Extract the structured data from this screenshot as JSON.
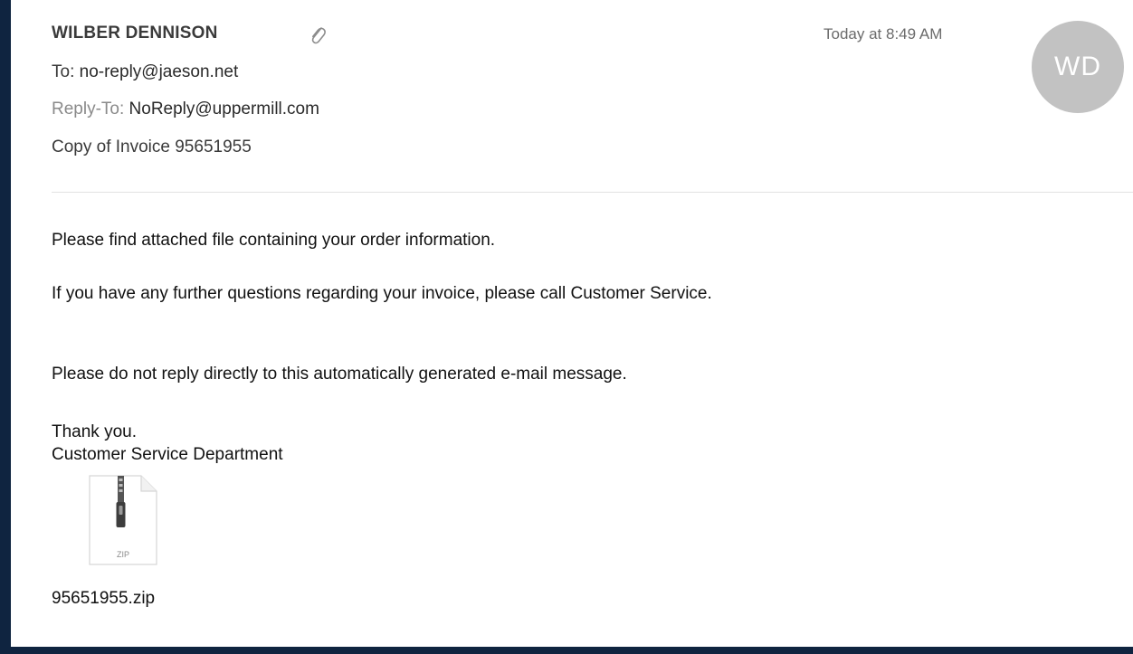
{
  "message": {
    "sender": "WILBER DENNISON",
    "date": "Today at 8:49 AM",
    "avatar_initials": "WD",
    "to_label": "To:",
    "to_value": "no-reply@jaeson.net",
    "reply_to_label": "Reply-To:",
    "reply_to_value": "NoReply@uppermill.com",
    "subject": "Copy of Invoice 95651955"
  },
  "body": {
    "line1": "Please find attached file containing your order information.",
    "line2": "If you have any further questions regarding your invoice, please call Customer Service.",
    "line3": "Please do not reply directly to this automatically generated e-mail message.",
    "line4": "Thank you.",
    "line5": "Customer Service Department"
  },
  "attachment": {
    "icon": "zip-file-icon",
    "type_label": "ZIP",
    "filename": "95651955.zip"
  },
  "icons": {
    "attachment_indicator": "paperclip-icon"
  },
  "colors": {
    "background_border": "#0f2440",
    "avatar": "#c2c2c2"
  }
}
